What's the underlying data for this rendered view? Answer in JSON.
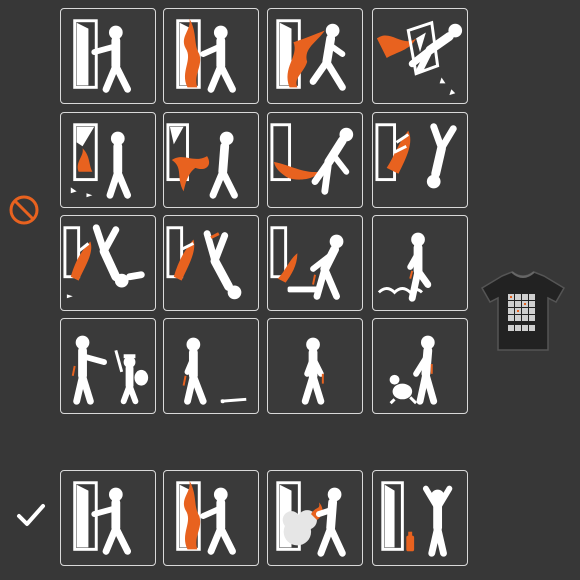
{
  "colors": {
    "background": "#373737",
    "panel_border": "#d9d9d9",
    "figure": "#ffffff",
    "fire": "#e8621f",
    "prohibited_icon": "#e8621f",
    "approved_icon": "#ffffff"
  },
  "icons": {
    "prohibited": "no-symbol-icon",
    "approved": "checkmark-icon",
    "shirt": "t-shirt-preview-icon"
  },
  "grids": {
    "prohibited_rows": 4,
    "prohibited_cols": 4,
    "approved_panels": 4
  }
}
